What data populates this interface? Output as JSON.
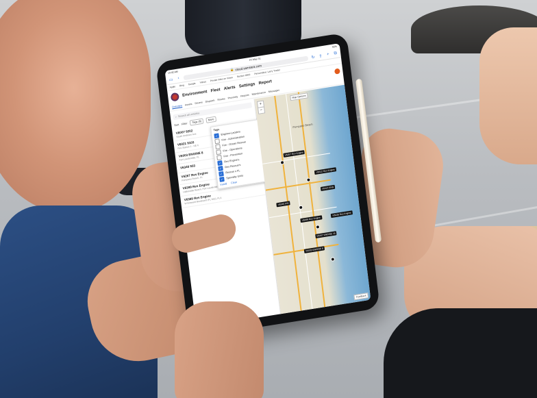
{
  "browser": {
    "status_time": "10:42 AM",
    "status_date": "Fri May 31",
    "battery": "92%",
    "url": "cloud.samsara.com",
    "bookmarks": [
      "Apple",
      "Bing",
      "Google",
      "Yahoo",
      "Private rides on Views",
      "Section 8900",
      "Personalize: Larry Trader"
    ]
  },
  "app": {
    "nav": [
      "Environment",
      "Fleet",
      "Alerts",
      "Settings",
      "Report"
    ],
    "subnav": [
      "Overview",
      "Assets",
      "Drivers",
      "Dispatch",
      "Routes",
      "Proximity",
      "Reports",
      "Maintenance",
      "Messages"
    ],
    "active_subnav": "Overview",
    "search_placeholder": "Search all vehicles",
    "filter": {
      "sort": "Sort",
      "filter": "Filter",
      "tags": "Tags (6)",
      "more": "More"
    }
  },
  "vehicles": [
    {
      "name": "V6007 9202",
      "loc": "South Andrews Ave"
    },
    {
      "name": "V6021 9103",
      "loc": "Fire Station 1 - NE 6"
    },
    {
      "name": "V6003 ENGINE 8",
      "loc": "Fort Lauderdale, FL"
    },
    {
      "name": "V6346 933",
      "loc": ""
    },
    {
      "name": "V6267 Res Engine",
      "loc": "Pompano Beach, FL"
    },
    {
      "name": "V6399 Res Engine",
      "loc": "Hallandale Beach, Fort Lauderdale, FL"
    },
    {
      "name": "V6389 Res Engine",
      "loc": "W Broward Boulevard (FL 842), FLA"
    }
  ],
  "tags": {
    "title": "Tags",
    "items": [
      {
        "label": "Engines-Ladders",
        "checked": true
      },
      {
        "label": "Fire - Administration",
        "checked": false
      },
      {
        "label": "Fire - Ocean Rescue",
        "checked": false
      },
      {
        "label": "Fire - Operations",
        "checked": false
      },
      {
        "label": "Fire - Prevention",
        "checked": false
      },
      {
        "label": "Res Engine's",
        "checked": true
      },
      {
        "label": "Res Rescue's",
        "checked": true
      },
      {
        "label": "Rescue s FL",
        "checked": true
      },
      {
        "label": "Specialty Units",
        "checked": true
      }
    ],
    "install": "Install",
    "clear": "Clear"
  },
  "map": {
    "options": "Map Options",
    "feedback": "Feedback",
    "city": "Pompano Beach",
    "labels": [
      "V6267 Res Engine",
      "V6312 Res Engine",
      "V6414 ENG",
      "V6346 933",
      "V6399 Res Engine",
      "V6307 ENGINE 16",
      "V6003 ENGINE 8",
      "V6226 Res Engine"
    ]
  },
  "colors": {
    "accent": "#2a6fd6",
    "map_water": "#6ea6cf",
    "highway": "#f0b23c"
  }
}
